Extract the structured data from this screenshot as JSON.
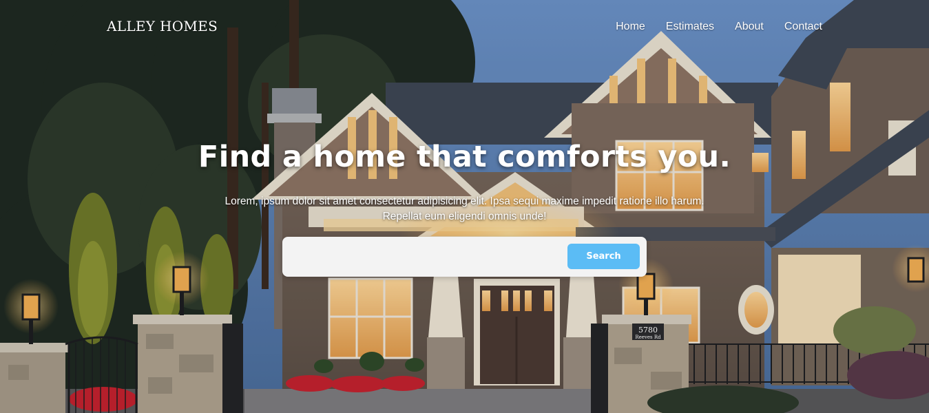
{
  "brand": {
    "logo_text": "ALLEY HOMES"
  },
  "nav": {
    "items": [
      {
        "label": "Home"
      },
      {
        "label": "Estimates"
      },
      {
        "label": "About"
      },
      {
        "label": "Contact"
      }
    ]
  },
  "hero": {
    "headline": "Find a home that comforts you.",
    "subtext_line1": "Lorem, ipsum dolor sit amet consectetur adipisicing elit. Ipsa sequi maxime impedit ratione illo harum.",
    "subtext_line2": "Repellat eum eligendi omnis unde!",
    "house_number": "5780",
    "street": "Reeves Rd"
  },
  "search": {
    "value": "",
    "placeholder": "",
    "button_label": "Search"
  },
  "colors": {
    "accent": "#5bbcf5",
    "search_bg": "#f3f3f3",
    "text": "#ffffff"
  }
}
